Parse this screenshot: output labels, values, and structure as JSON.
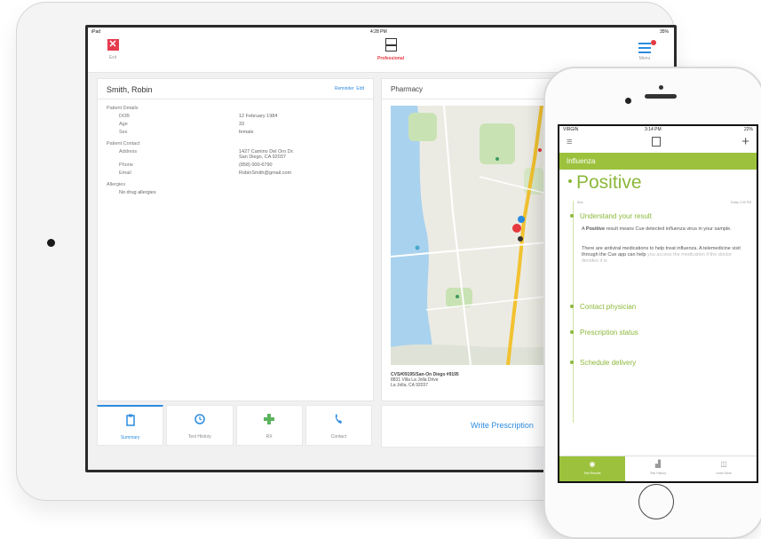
{
  "ipad": {
    "status": {
      "carrier": "iPad",
      "time": "4:28 PM",
      "battery": "35%"
    },
    "toolbar": {
      "exit_label": "Exit",
      "mode_label": "Professional",
      "menu_label": "Menu"
    },
    "patient": {
      "name": "Smith, Robin",
      "reminder_link": "Reminder",
      "edit_link": "Edit",
      "details_title": "Patient Details",
      "dob_label": "DOB",
      "dob": "12 February 1984",
      "age_label": "Age",
      "age": "33",
      "sex_label": "Sex",
      "sex": "female",
      "contact_title": "Patient Contact",
      "address_label": "Address",
      "address": "1427 Camino Del Oro Dr.\nSan Diego, CA 92037",
      "phone_label": "Phone",
      "phone": "(858) 000-6790",
      "email_label": "Email",
      "email": "RobinSmith@gmail.com",
      "allergies_title": "Allergies",
      "allergies": "No drug allergies"
    },
    "pharmacy": {
      "title": "Pharmacy",
      "store": "CVS#09195/San-On Diego #9195",
      "address_line1": "8831 Villa La Jolla Drive",
      "address_line2": "La Jolla, CA 92037"
    },
    "tabs": [
      {
        "label": "Summary",
        "icon": "clipboard-icon"
      },
      {
        "label": "Test History",
        "icon": "clock-icon"
      },
      {
        "label": "RX",
        "icon": "plus-icon"
      },
      {
        "label": "Contact",
        "icon": "phone-icon"
      }
    ],
    "write_prescription": "Write Prescription"
  },
  "iphone": {
    "status": {
      "carrier": "VIRGIN",
      "time": "3:14 PM",
      "battery": "22%"
    },
    "section_title": "Influenza",
    "result": "Positive",
    "result_label": "Sick",
    "result_time": "Today 2:30 PM",
    "understand_title": "Understand your result",
    "understand_text_pre": "A ",
    "understand_text_bold": "Positive",
    "understand_text_post": " result means Cue detected influenza virus in your sample.",
    "antiviral_text": "There are antiviral medications to help treat influenza. A telemedicine visit through the Cue app can help",
    "antiviral_fade": "you access the medication if the doctor decides it is",
    "contact_title": "Contact physician",
    "prescription_title": "Prescription status",
    "delivery_title": "Schedule delivery",
    "footer": [
      {
        "label": "Test Results",
        "icon": "target-icon"
      },
      {
        "label": "Test History",
        "icon": "chart-icon"
      },
      {
        "label": "Learn More",
        "icon": "book-icon"
      }
    ]
  },
  "colors": {
    "accent": "#2c8be0",
    "cue_green": "#9cc23d",
    "exit_red": "#e63b4e"
  }
}
